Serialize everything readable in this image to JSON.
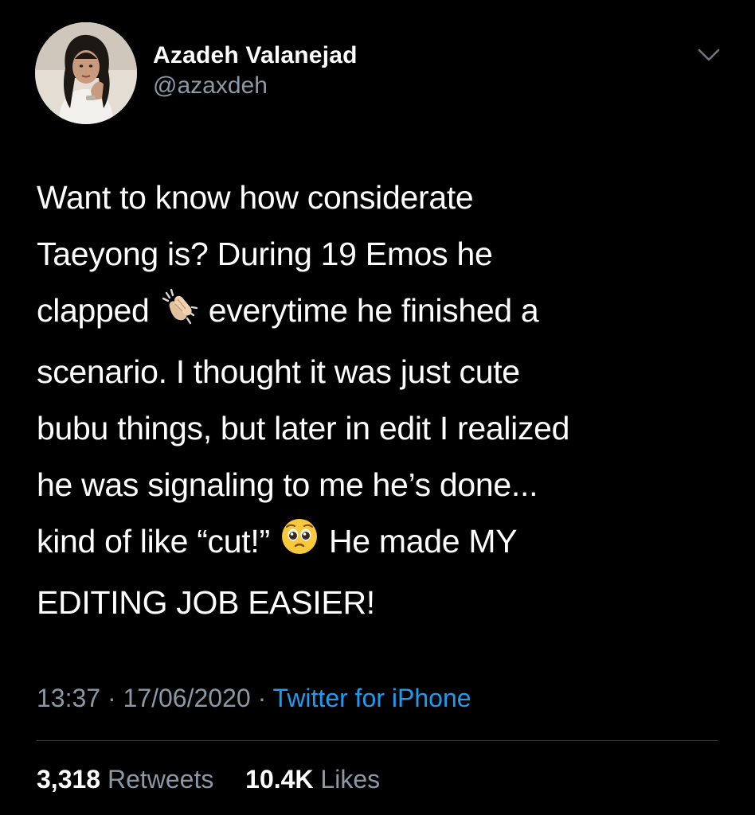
{
  "author": {
    "display_name": "Azadeh Valanejad",
    "handle": "@azaxdeh"
  },
  "tweet": {
    "line1": "Want to know how considerate",
    "line2": "Taeyong is? During 19 Emos he",
    "line3_a": "clapped",
    "line3_b": "everytime he finished a",
    "line4": "scenario. I thought it was just cute",
    "line5": "bubu things, but later in edit I realized",
    "line6": "he was signaling to me he’s done...",
    "line7_a": "kind of like “cut!”",
    "line7_b": "He made MY",
    "line8": "EDITING JOB EASIER!",
    "emoji_1": "clapping-hands-icon",
    "emoji_2": "pleading-face-icon"
  },
  "meta": {
    "time": "13:37",
    "separator": "·",
    "date": "17/06/2020",
    "source": "Twitter for iPhone"
  },
  "stats": {
    "retweets_count": "3,318",
    "retweets_label": "Retweets",
    "likes_count": "10.4K",
    "likes_label": "Likes"
  },
  "colors": {
    "background": "#000000",
    "text": "#ffffff",
    "secondary": "#8b98a5",
    "link": "#1d9bf0",
    "divider": "#2f3336"
  }
}
